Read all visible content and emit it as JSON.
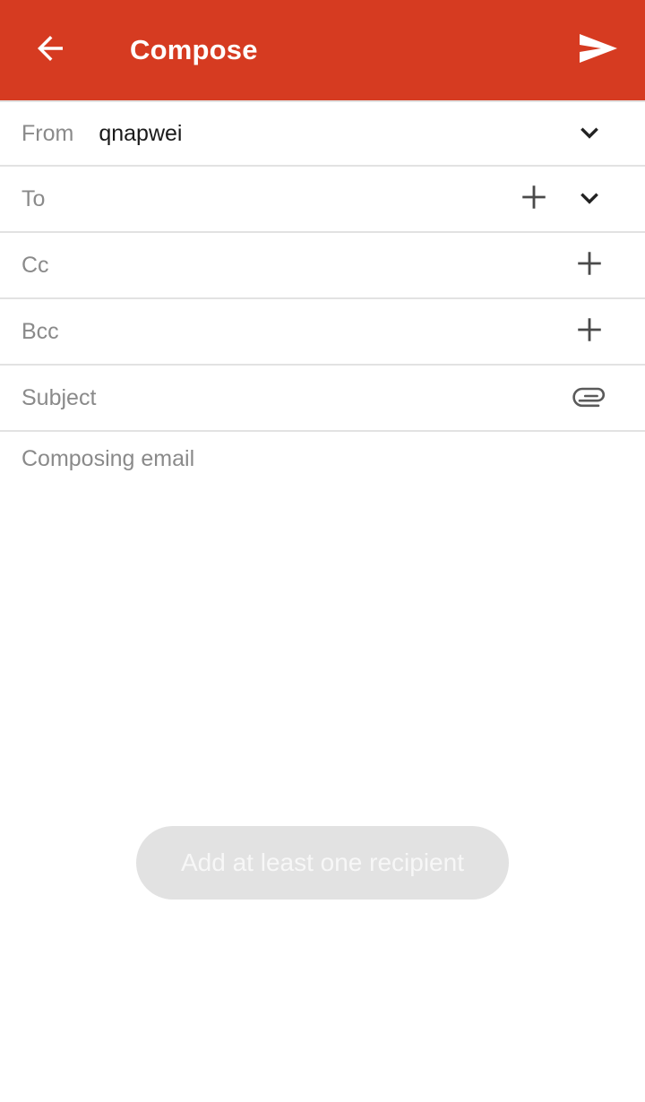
{
  "theme": {
    "appbar_bg": "#d63b21",
    "appbar_fg": "#ffffff",
    "divider": "#e2e2e2",
    "label_gray": "#8a8a8a",
    "value_black": "#1a1a1a",
    "icon_gray": "#4a4a4a",
    "toast_bg": "#e2e2e2",
    "toast_text": "#f7f7f7"
  },
  "appbar": {
    "back_icon": "arrow-left-icon",
    "title": "Compose",
    "send_icon": "send-icon"
  },
  "fields": [
    {
      "id": "from",
      "label": "From",
      "value": "qnapwei",
      "placeholder": "",
      "has_plus": false,
      "has_chevron": true,
      "has_clip": false
    },
    {
      "id": "to",
      "label": "To",
      "value": "",
      "placeholder": "To",
      "has_plus": true,
      "has_chevron": true,
      "has_clip": false
    },
    {
      "id": "cc",
      "label": "Cc",
      "value": "",
      "placeholder": "Cc",
      "has_plus": true,
      "has_chevron": false,
      "has_clip": false
    },
    {
      "id": "bcc",
      "label": "Bcc",
      "value": "",
      "placeholder": "Bcc",
      "has_plus": true,
      "has_chevron": false,
      "has_clip": false
    },
    {
      "id": "subject",
      "label": "Subject",
      "value": "",
      "placeholder": "Subject",
      "has_plus": false,
      "has_chevron": false,
      "has_clip": true
    }
  ],
  "icons": {
    "plus": "plus-icon",
    "chevron_down": "chevron-down-icon",
    "attachment": "paperclip-icon"
  },
  "body": {
    "placeholder": "Composing email",
    "value": ""
  },
  "toast": {
    "message": "Add at least one recipient"
  }
}
